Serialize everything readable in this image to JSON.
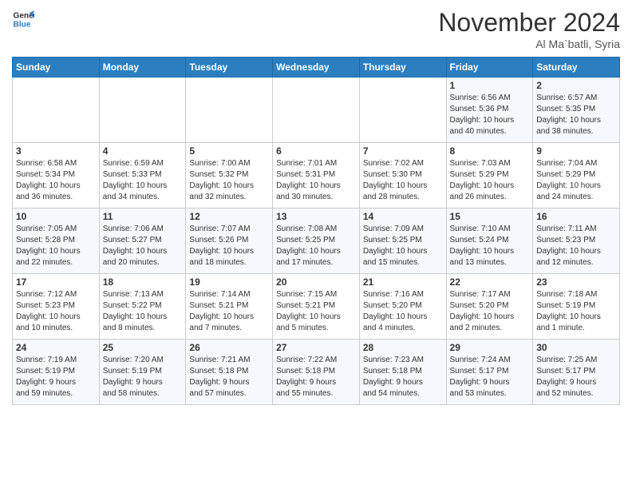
{
  "header": {
    "logo_line1": "General",
    "logo_line2": "Blue",
    "month_year": "November 2024",
    "location": "Al Ma`batli, Syria"
  },
  "weekdays": [
    "Sunday",
    "Monday",
    "Tuesday",
    "Wednesday",
    "Thursday",
    "Friday",
    "Saturday"
  ],
  "weeks": [
    [
      {
        "day": "",
        "info": ""
      },
      {
        "day": "",
        "info": ""
      },
      {
        "day": "",
        "info": ""
      },
      {
        "day": "",
        "info": ""
      },
      {
        "day": "",
        "info": ""
      },
      {
        "day": "1",
        "info": "Sunrise: 6:56 AM\nSunset: 5:36 PM\nDaylight: 10 hours\nand 40 minutes."
      },
      {
        "day": "2",
        "info": "Sunrise: 6:57 AM\nSunset: 5:35 PM\nDaylight: 10 hours\nand 38 minutes."
      }
    ],
    [
      {
        "day": "3",
        "info": "Sunrise: 6:58 AM\nSunset: 5:34 PM\nDaylight: 10 hours\nand 36 minutes."
      },
      {
        "day": "4",
        "info": "Sunrise: 6:59 AM\nSunset: 5:33 PM\nDaylight: 10 hours\nand 34 minutes."
      },
      {
        "day": "5",
        "info": "Sunrise: 7:00 AM\nSunset: 5:32 PM\nDaylight: 10 hours\nand 32 minutes."
      },
      {
        "day": "6",
        "info": "Sunrise: 7:01 AM\nSunset: 5:31 PM\nDaylight: 10 hours\nand 30 minutes."
      },
      {
        "day": "7",
        "info": "Sunrise: 7:02 AM\nSunset: 5:30 PM\nDaylight: 10 hours\nand 28 minutes."
      },
      {
        "day": "8",
        "info": "Sunrise: 7:03 AM\nSunset: 5:29 PM\nDaylight: 10 hours\nand 26 minutes."
      },
      {
        "day": "9",
        "info": "Sunrise: 7:04 AM\nSunset: 5:29 PM\nDaylight: 10 hours\nand 24 minutes."
      }
    ],
    [
      {
        "day": "10",
        "info": "Sunrise: 7:05 AM\nSunset: 5:28 PM\nDaylight: 10 hours\nand 22 minutes."
      },
      {
        "day": "11",
        "info": "Sunrise: 7:06 AM\nSunset: 5:27 PM\nDaylight: 10 hours\nand 20 minutes."
      },
      {
        "day": "12",
        "info": "Sunrise: 7:07 AM\nSunset: 5:26 PM\nDaylight: 10 hours\nand 18 minutes."
      },
      {
        "day": "13",
        "info": "Sunrise: 7:08 AM\nSunset: 5:25 PM\nDaylight: 10 hours\nand 17 minutes."
      },
      {
        "day": "14",
        "info": "Sunrise: 7:09 AM\nSunset: 5:25 PM\nDaylight: 10 hours\nand 15 minutes."
      },
      {
        "day": "15",
        "info": "Sunrise: 7:10 AM\nSunset: 5:24 PM\nDaylight: 10 hours\nand 13 minutes."
      },
      {
        "day": "16",
        "info": "Sunrise: 7:11 AM\nSunset: 5:23 PM\nDaylight: 10 hours\nand 12 minutes."
      }
    ],
    [
      {
        "day": "17",
        "info": "Sunrise: 7:12 AM\nSunset: 5:23 PM\nDaylight: 10 hours\nand 10 minutes."
      },
      {
        "day": "18",
        "info": "Sunrise: 7:13 AM\nSunset: 5:22 PM\nDaylight: 10 hours\nand 8 minutes."
      },
      {
        "day": "19",
        "info": "Sunrise: 7:14 AM\nSunset: 5:21 PM\nDaylight: 10 hours\nand 7 minutes."
      },
      {
        "day": "20",
        "info": "Sunrise: 7:15 AM\nSunset: 5:21 PM\nDaylight: 10 hours\nand 5 minutes."
      },
      {
        "day": "21",
        "info": "Sunrise: 7:16 AM\nSunset: 5:20 PM\nDaylight: 10 hours\nand 4 minutes."
      },
      {
        "day": "22",
        "info": "Sunrise: 7:17 AM\nSunset: 5:20 PM\nDaylight: 10 hours\nand 2 minutes."
      },
      {
        "day": "23",
        "info": "Sunrise: 7:18 AM\nSunset: 5:19 PM\nDaylight: 10 hours\nand 1 minute."
      }
    ],
    [
      {
        "day": "24",
        "info": "Sunrise: 7:19 AM\nSunset: 5:19 PM\nDaylight: 9 hours\nand 59 minutes."
      },
      {
        "day": "25",
        "info": "Sunrise: 7:20 AM\nSunset: 5:19 PM\nDaylight: 9 hours\nand 58 minutes."
      },
      {
        "day": "26",
        "info": "Sunrise: 7:21 AM\nSunset: 5:18 PM\nDaylight: 9 hours\nand 57 minutes."
      },
      {
        "day": "27",
        "info": "Sunrise: 7:22 AM\nSunset: 5:18 PM\nDaylight: 9 hours\nand 55 minutes."
      },
      {
        "day": "28",
        "info": "Sunrise: 7:23 AM\nSunset: 5:18 PM\nDaylight: 9 hours\nand 54 minutes."
      },
      {
        "day": "29",
        "info": "Sunrise: 7:24 AM\nSunset: 5:17 PM\nDaylight: 9 hours\nand 53 minutes."
      },
      {
        "day": "30",
        "info": "Sunrise: 7:25 AM\nSunset: 5:17 PM\nDaylight: 9 hours\nand 52 minutes."
      }
    ]
  ]
}
